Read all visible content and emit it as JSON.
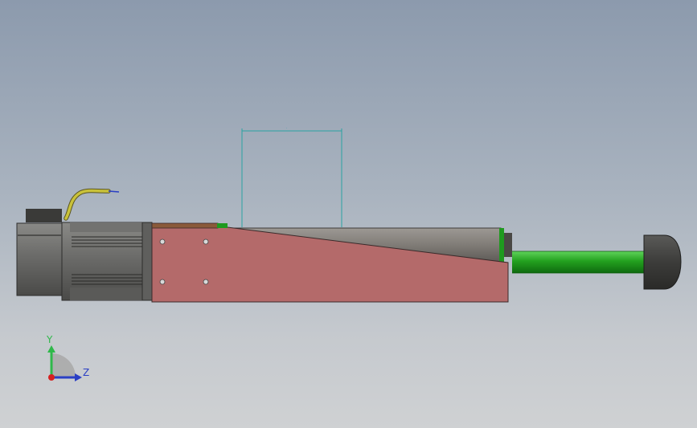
{
  "viewport": {
    "background_top": "#8c9aad",
    "background_bottom": "#cfd1d3"
  },
  "model": {
    "colors": {
      "motor_body": "#6b6b69",
      "motor_dark": "#3a3a38",
      "housing": "#b46a6a",
      "barrel": "#807c77",
      "rod": "#23a11f",
      "green_trim": "#1f9a1f",
      "cap": "#3c3c3a",
      "cable": "#c9c23a",
      "dimension_line": "#2aa3a3"
    },
    "dimension_text": "·"
  },
  "triad": {
    "y_label": "Y",
    "z_label": "Z",
    "y_color": "#2fb84a",
    "z_color": "#2a3fc4",
    "origin_color": "#d62020"
  }
}
